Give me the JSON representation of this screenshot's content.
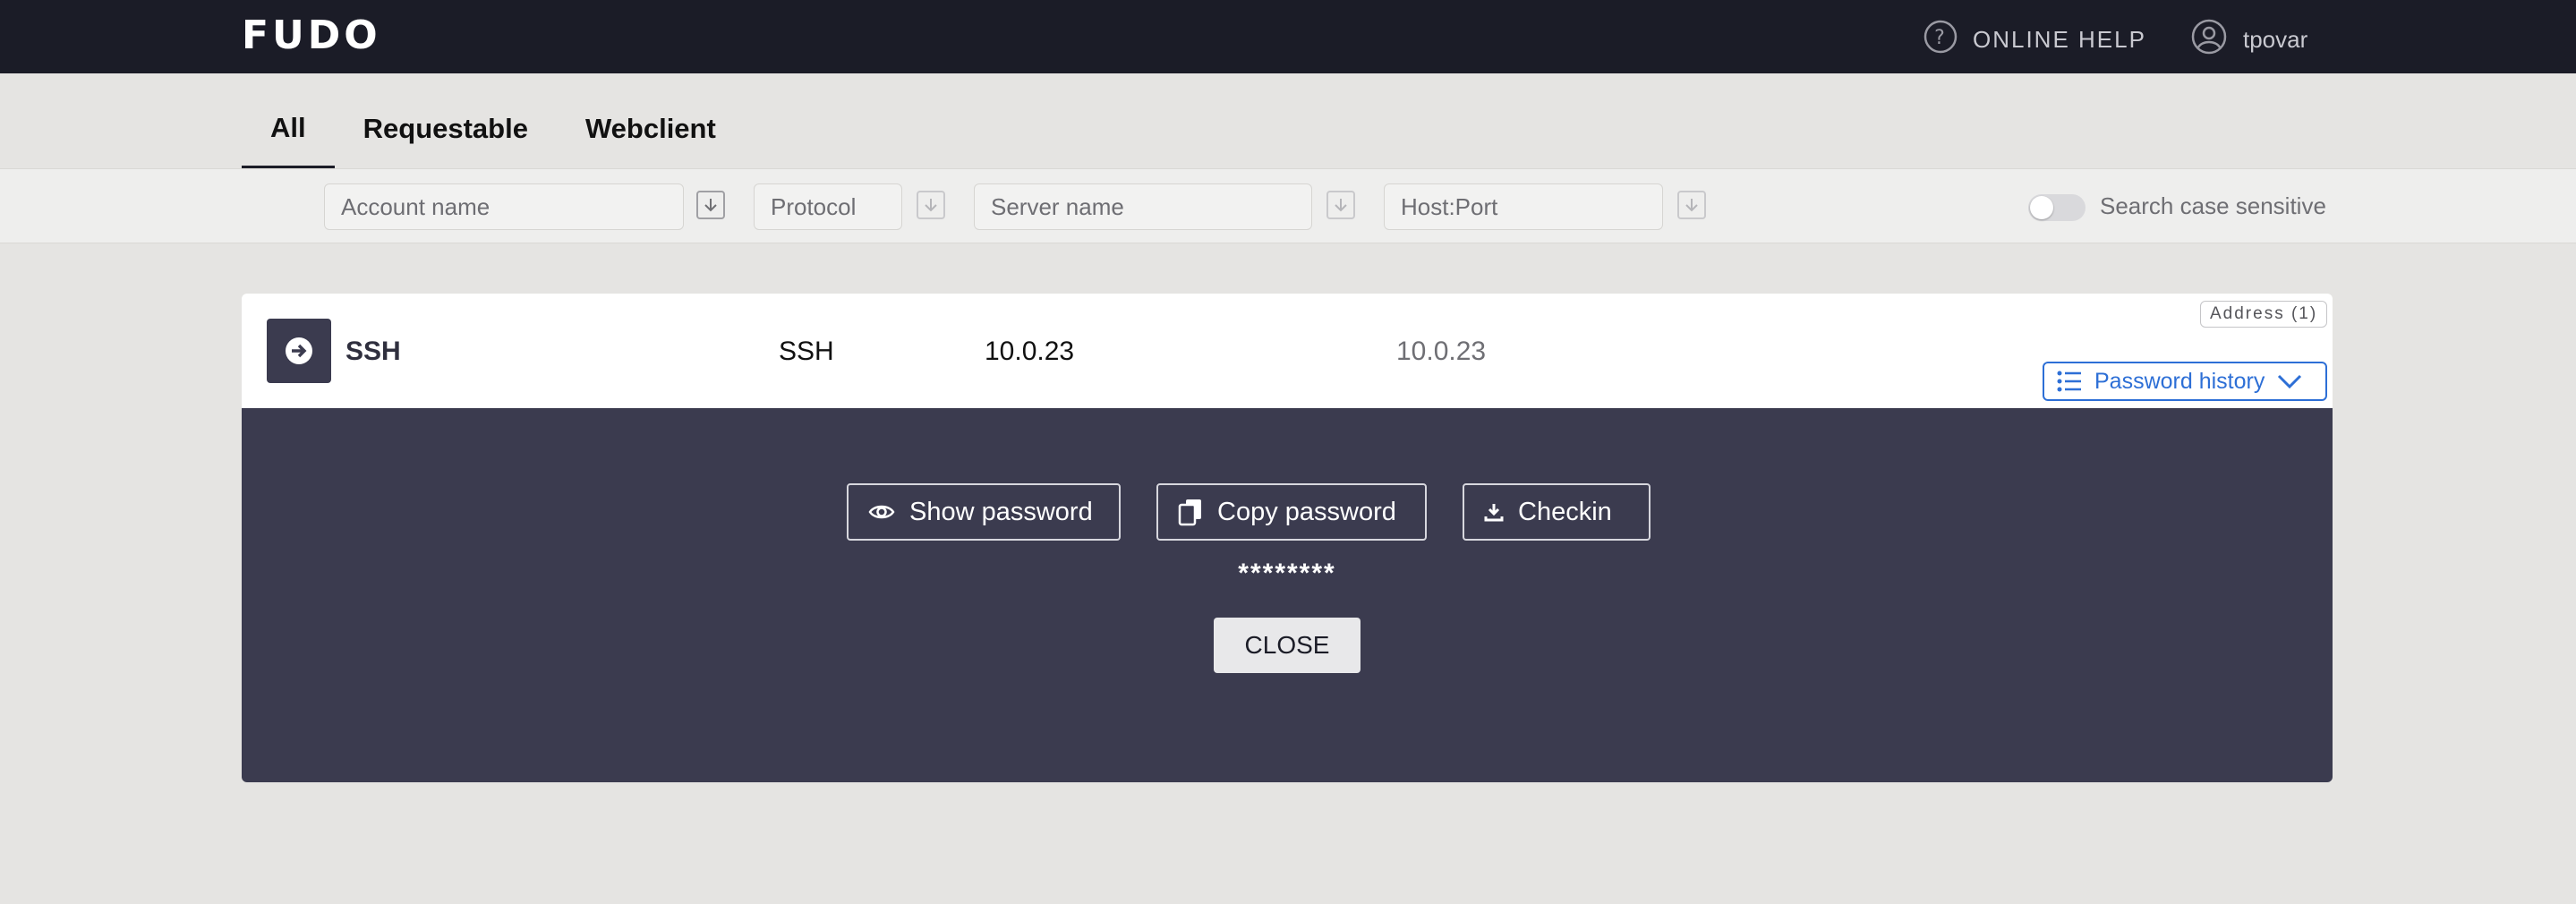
{
  "header": {
    "logo": "FUDO",
    "help_label": "ONLINE HELP",
    "username": "tpovar",
    "help_icon": "question-circle-icon",
    "user_icon": "user-circle-icon"
  },
  "tabs": [
    {
      "label": "All",
      "active": true
    },
    {
      "label": "Requestable",
      "active": false
    },
    {
      "label": "Webclient",
      "active": false
    }
  ],
  "filters": {
    "account_placeholder": "Account name",
    "protocol_placeholder": "Protocol",
    "server_placeholder": "Server name",
    "hostport_placeholder": "Host:Port",
    "case_sensitive_label": "Search case sensitive",
    "case_sensitive_on": false
  },
  "account": {
    "name": "SSH",
    "protocol": "SSH",
    "server": "10.0.23",
    "host": "10.0.23",
    "address_badge": "Address (1)",
    "history_label": "Password history"
  },
  "panel": {
    "show_label": "Show password",
    "copy_label": "Copy password",
    "checkin_label": "Checkin",
    "masked_password": "********",
    "close_label": "CLOSE"
  },
  "colors": {
    "topbar": "#1b1c27",
    "panel": "#3b3b4f",
    "accent": "#2d6fd6",
    "background": "#e5e4e2"
  }
}
